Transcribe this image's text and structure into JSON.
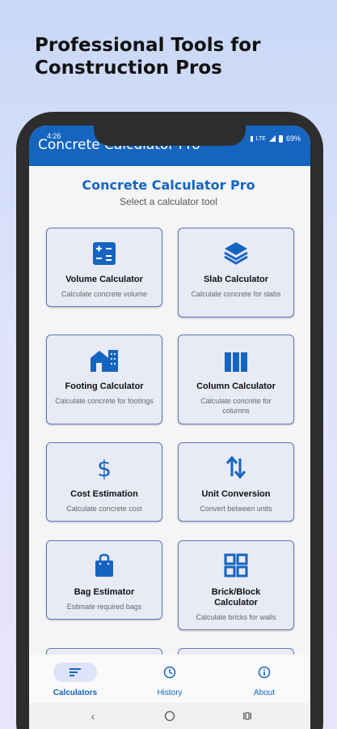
{
  "headline": [
    "Professional Tools for",
    "Construction Pros"
  ],
  "status": {
    "time": "4:26",
    "battery": "69%",
    "lte": "LTE"
  },
  "appbar_title": "Concrete Calculator Pro",
  "page_title": "Concrete Calculator Pro",
  "page_subtitle": "Select a calculator tool",
  "cards": [
    {
      "title": "Volume Calculator",
      "desc": "Calculate concrete volume",
      "icon": "calculator-icon"
    },
    {
      "title": "Slab Calculator",
      "desc": "Calculate concrete for slabs",
      "icon": "layers-icon"
    },
    {
      "title": "Footing Calculator",
      "desc": "Calculate concrete for footings",
      "icon": "building-icon"
    },
    {
      "title": "Column Calculator",
      "desc": "Calculate concrete for columns",
      "icon": "columns-icon"
    },
    {
      "title": "Cost Estimation",
      "desc": "Calculate concrete cost",
      "icon": "dollar-icon"
    },
    {
      "title": "Unit Conversion",
      "desc": "Convert between units",
      "icon": "swap-arrows-icon"
    },
    {
      "title": "Bag Estimator",
      "desc": "Estimate required bags",
      "icon": "bag-icon"
    },
    {
      "title": "Brick/Block Calculator",
      "desc": "Calculate bricks for walls",
      "icon": "grid-icon"
    }
  ],
  "nav": [
    {
      "label": "Calculators",
      "icon": "list-icon"
    },
    {
      "label": "History",
      "icon": "clock-icon"
    },
    {
      "label": "About",
      "icon": "info-icon"
    }
  ],
  "colors": {
    "primary": "#1565c0",
    "card_bg": "#e8eaf6",
    "card_border": "#5b79b5"
  }
}
